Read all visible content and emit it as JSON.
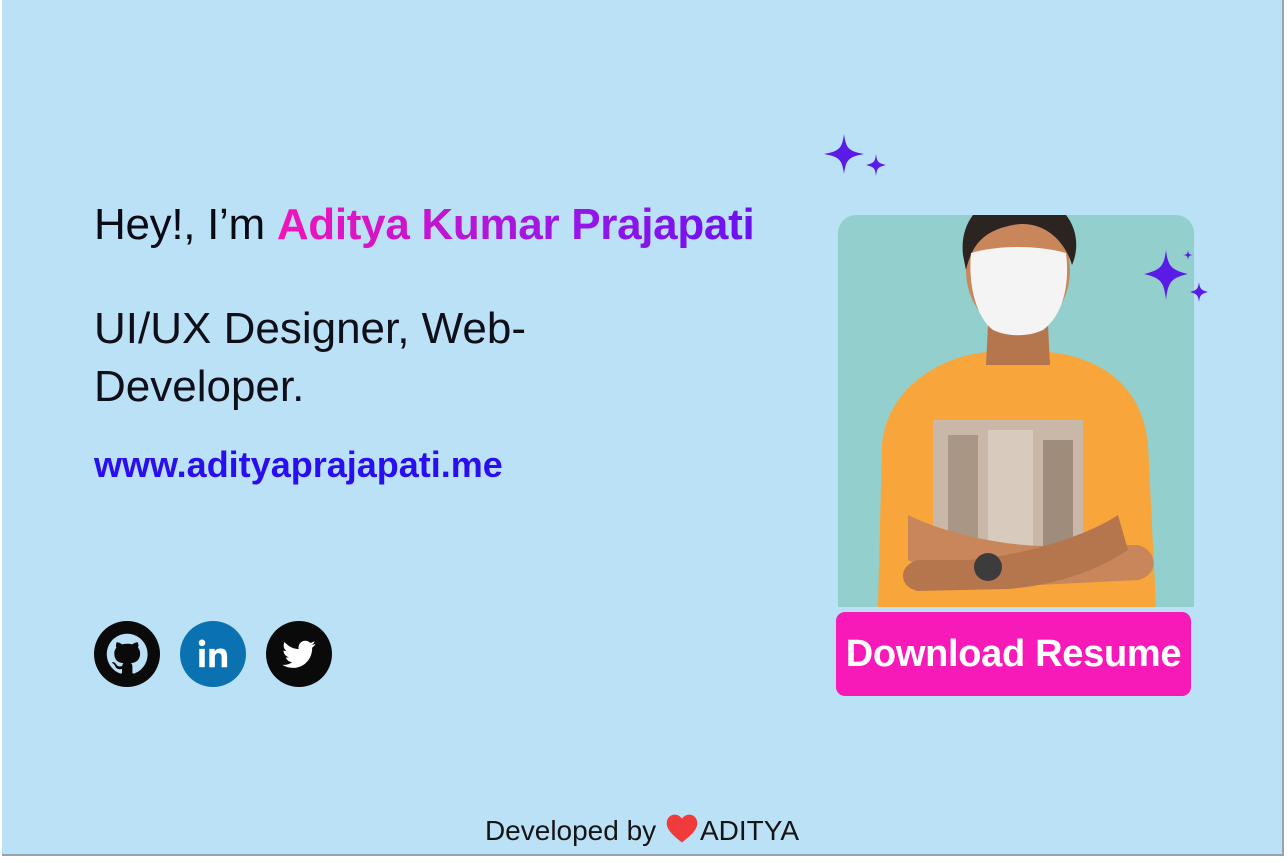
{
  "hero": {
    "greeting_prefix": "Hey!, I’m ",
    "name": "Aditya Kumar Prajapati",
    "role": "UI/UX Designer, Web-Developer.",
    "website": "www.adityaprajapati.me"
  },
  "socials": [
    {
      "name": "github",
      "icon": "github-icon"
    },
    {
      "name": "linkedin",
      "icon": "linkedin-icon"
    },
    {
      "name": "twitter",
      "icon": "twitter-icon"
    }
  ],
  "download_button": {
    "label": "Download Resume"
  },
  "footer": {
    "prefix": "Developed by ",
    "heart_icon": "heart-icon",
    "author": "ADITYA"
  },
  "colors": {
    "background": "#bbe1f6",
    "name_gradient_start": "#f313b8",
    "name_gradient_end": "#6a11f0",
    "link": "#2a0ef0",
    "button": "#f71ab9",
    "sparkle": "#5b1be6",
    "linkedin": "#0a72b1",
    "heart": "#ef3b3b",
    "photo_panel": "#93cfcc"
  }
}
